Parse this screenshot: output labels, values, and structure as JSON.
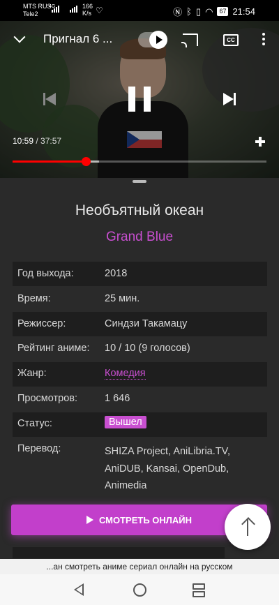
{
  "status_bar": {
    "carrier1": "MTS RUS",
    "carrier2": "Tele2",
    "net_type": "4G",
    "speed_value": "166",
    "speed_unit": "K/s",
    "battery": "67",
    "time": "21:54"
  },
  "player": {
    "title": "Пригнал 6 ...",
    "current_time": "10:59",
    "separator": " / ",
    "duration": "37:57",
    "progress_fraction": 0.288,
    "buffered_fraction": 0.34,
    "cc_label": "CC"
  },
  "anime": {
    "title": "Необъятный океан",
    "original_title": "Grand Blue"
  },
  "info_rows": [
    {
      "key": "Год выхода:",
      "value": "2018"
    },
    {
      "key": "Время:",
      "value": "25 мин."
    },
    {
      "key": "Режиссер:",
      "value": "Синдзи Такамацу"
    },
    {
      "key": "Рейтинг аниме:",
      "value": "10 / 10 (9 голосов)"
    },
    {
      "key": "Жанр:",
      "value": "Комедия"
    },
    {
      "key": "Просмотров:",
      "value": "1 646"
    },
    {
      "key": "Статус:",
      "value": "Вышел"
    },
    {
      "key": "Перевод:",
      "value": "SHIZA Project, AniLibria.TV, AniDUB, Kansai, OpenDub, Animedia"
    }
  ],
  "watch_button": "СМОТРЕТЬ ОНЛАЙН",
  "browser": {
    "url_text": "...ан смотреть аниме сериал онлайн на русском"
  },
  "colors": {
    "accent": "#c84fd0",
    "progress": "#ff0000",
    "background": "#2a2a2a"
  }
}
